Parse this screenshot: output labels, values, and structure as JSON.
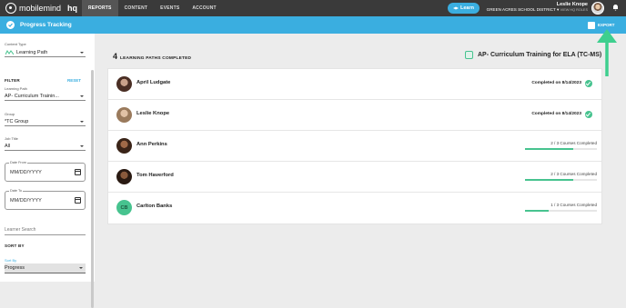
{
  "topbar": {
    "logo_text": "mobilemind",
    "hq_text": "hq",
    "nav": [
      "REPORTS",
      "CONTENT",
      "EVENTS",
      "ACCOUNT"
    ],
    "active_nav": "REPORTS",
    "learn_label": "Learn",
    "user_name": "Leslie Knope",
    "org_name": "GREEN ACRES SCHOOL DISTRICT",
    "role_label": "VIEW HQ ROLES"
  },
  "subbar": {
    "title": "Progress Tracking",
    "export_label": "EXPORT"
  },
  "sidebar": {
    "content_type_label": "Content Type",
    "content_type_value": "Learning Path",
    "filter_heading": "FILTER",
    "reset_label": "RESET",
    "learning_path_label": "Learning Path",
    "learning_path_value": "AP- Curriculum Trainin...",
    "group_label": "Group",
    "group_value": "*TC Group",
    "job_title_label": "Job Title",
    "job_title_value": "All",
    "date_from_label": "Date From",
    "date_from_placeholder": "MM/DD/YYYY",
    "date_to_label": "Date To",
    "date_to_placeholder": "MM/DD/YYYY",
    "learner_search_placeholder": "Learner Search",
    "sort_heading": "SORT BY",
    "sort_label": "Sort By",
    "sort_value": "Progress"
  },
  "main": {
    "completed_count": "4",
    "completed_label": "LEARNING PATHS COMPLETED",
    "path_title": "AP- Curriculum Training for ELA (TC-MS)",
    "learners": [
      {
        "name": "April Ludgate",
        "status": "Completed on 8/14/2023",
        "completed": true,
        "avatar_color": "#6b4a3a"
      },
      {
        "name": "Leslie Knope",
        "status": "Completed on 8/14/2023",
        "completed": true,
        "avatar_color": "#b08a6a"
      },
      {
        "name": "Ann Perkins",
        "status": "2 / 3 Courses Completed",
        "completed": false,
        "progress": 0.667,
        "avatar_color": "#7a4a2e"
      },
      {
        "name": "Tom Haverford",
        "status": "2 / 3 Courses Completed",
        "completed": false,
        "progress": 0.667,
        "avatar_color": "#5a3a2a"
      },
      {
        "name": "Carlton Banks",
        "status": "1 / 3 Courses Completed",
        "completed": false,
        "progress": 0.333,
        "initials": "CB",
        "avatar_color": "#47c38f"
      }
    ]
  },
  "colors": {
    "accent": "#3aaee0",
    "success": "#47c38f",
    "topbar": "#3a3a3a"
  }
}
